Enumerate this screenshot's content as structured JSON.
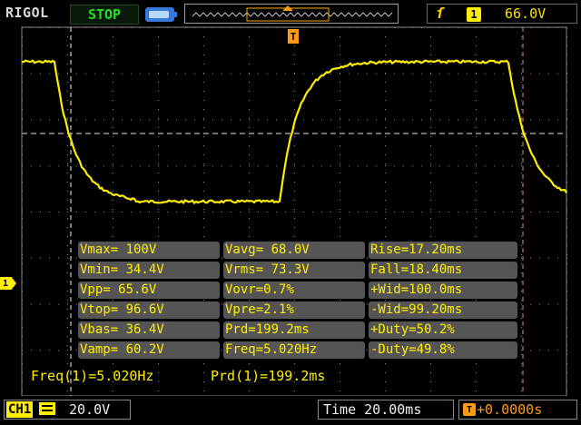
{
  "topbar": {
    "brand": "RIGOL",
    "run_state": "STOP",
    "trigger_slope_icon": "rising-edge-icon",
    "trigger_source": "1",
    "trigger_level": "66.0V"
  },
  "trigger_marker": "T",
  "channel_marker": "1",
  "measurements": {
    "col1": [
      "Vmax= 100V",
      "Vmin= 34.4V",
      "Vpp= 65.6V",
      "Vtop= 96.6V",
      "Vbas= 36.4V",
      "Vamp= 60.2V"
    ],
    "col2": [
      "Vavg= 68.0V",
      "Vrms= 73.3V",
      "Vovr=0.7%",
      "Vpre=2.1%",
      "Prd=199.2ms",
      "Freq=5.020Hz"
    ],
    "col3": [
      "Rise=17.20ms",
      "Fall=18.40ms",
      "+Wid=100.0ms",
      "-Wid=99.20ms",
      "+Duty=50.2%",
      "-Duty=49.8%"
    ]
  },
  "freq_readout": "Freq(1)=5.020Hz",
  "prd_readout": "Prd(1)=199.2ms",
  "bottombar": {
    "channel_label": "CH1",
    "coupling_icon": "dc-coupling-icon",
    "volts_per_div": "20.0V",
    "timebase": "Time 20.00ms",
    "trigger_position_icon": "trigger-position-icon",
    "trigger_position": "+0.0000s"
  },
  "colors": {
    "trace": "#ffee00",
    "trigger": "#ff9a10",
    "stop": "#22e022",
    "grid": "#8a8a8a",
    "cursor": "#c8a070"
  }
}
